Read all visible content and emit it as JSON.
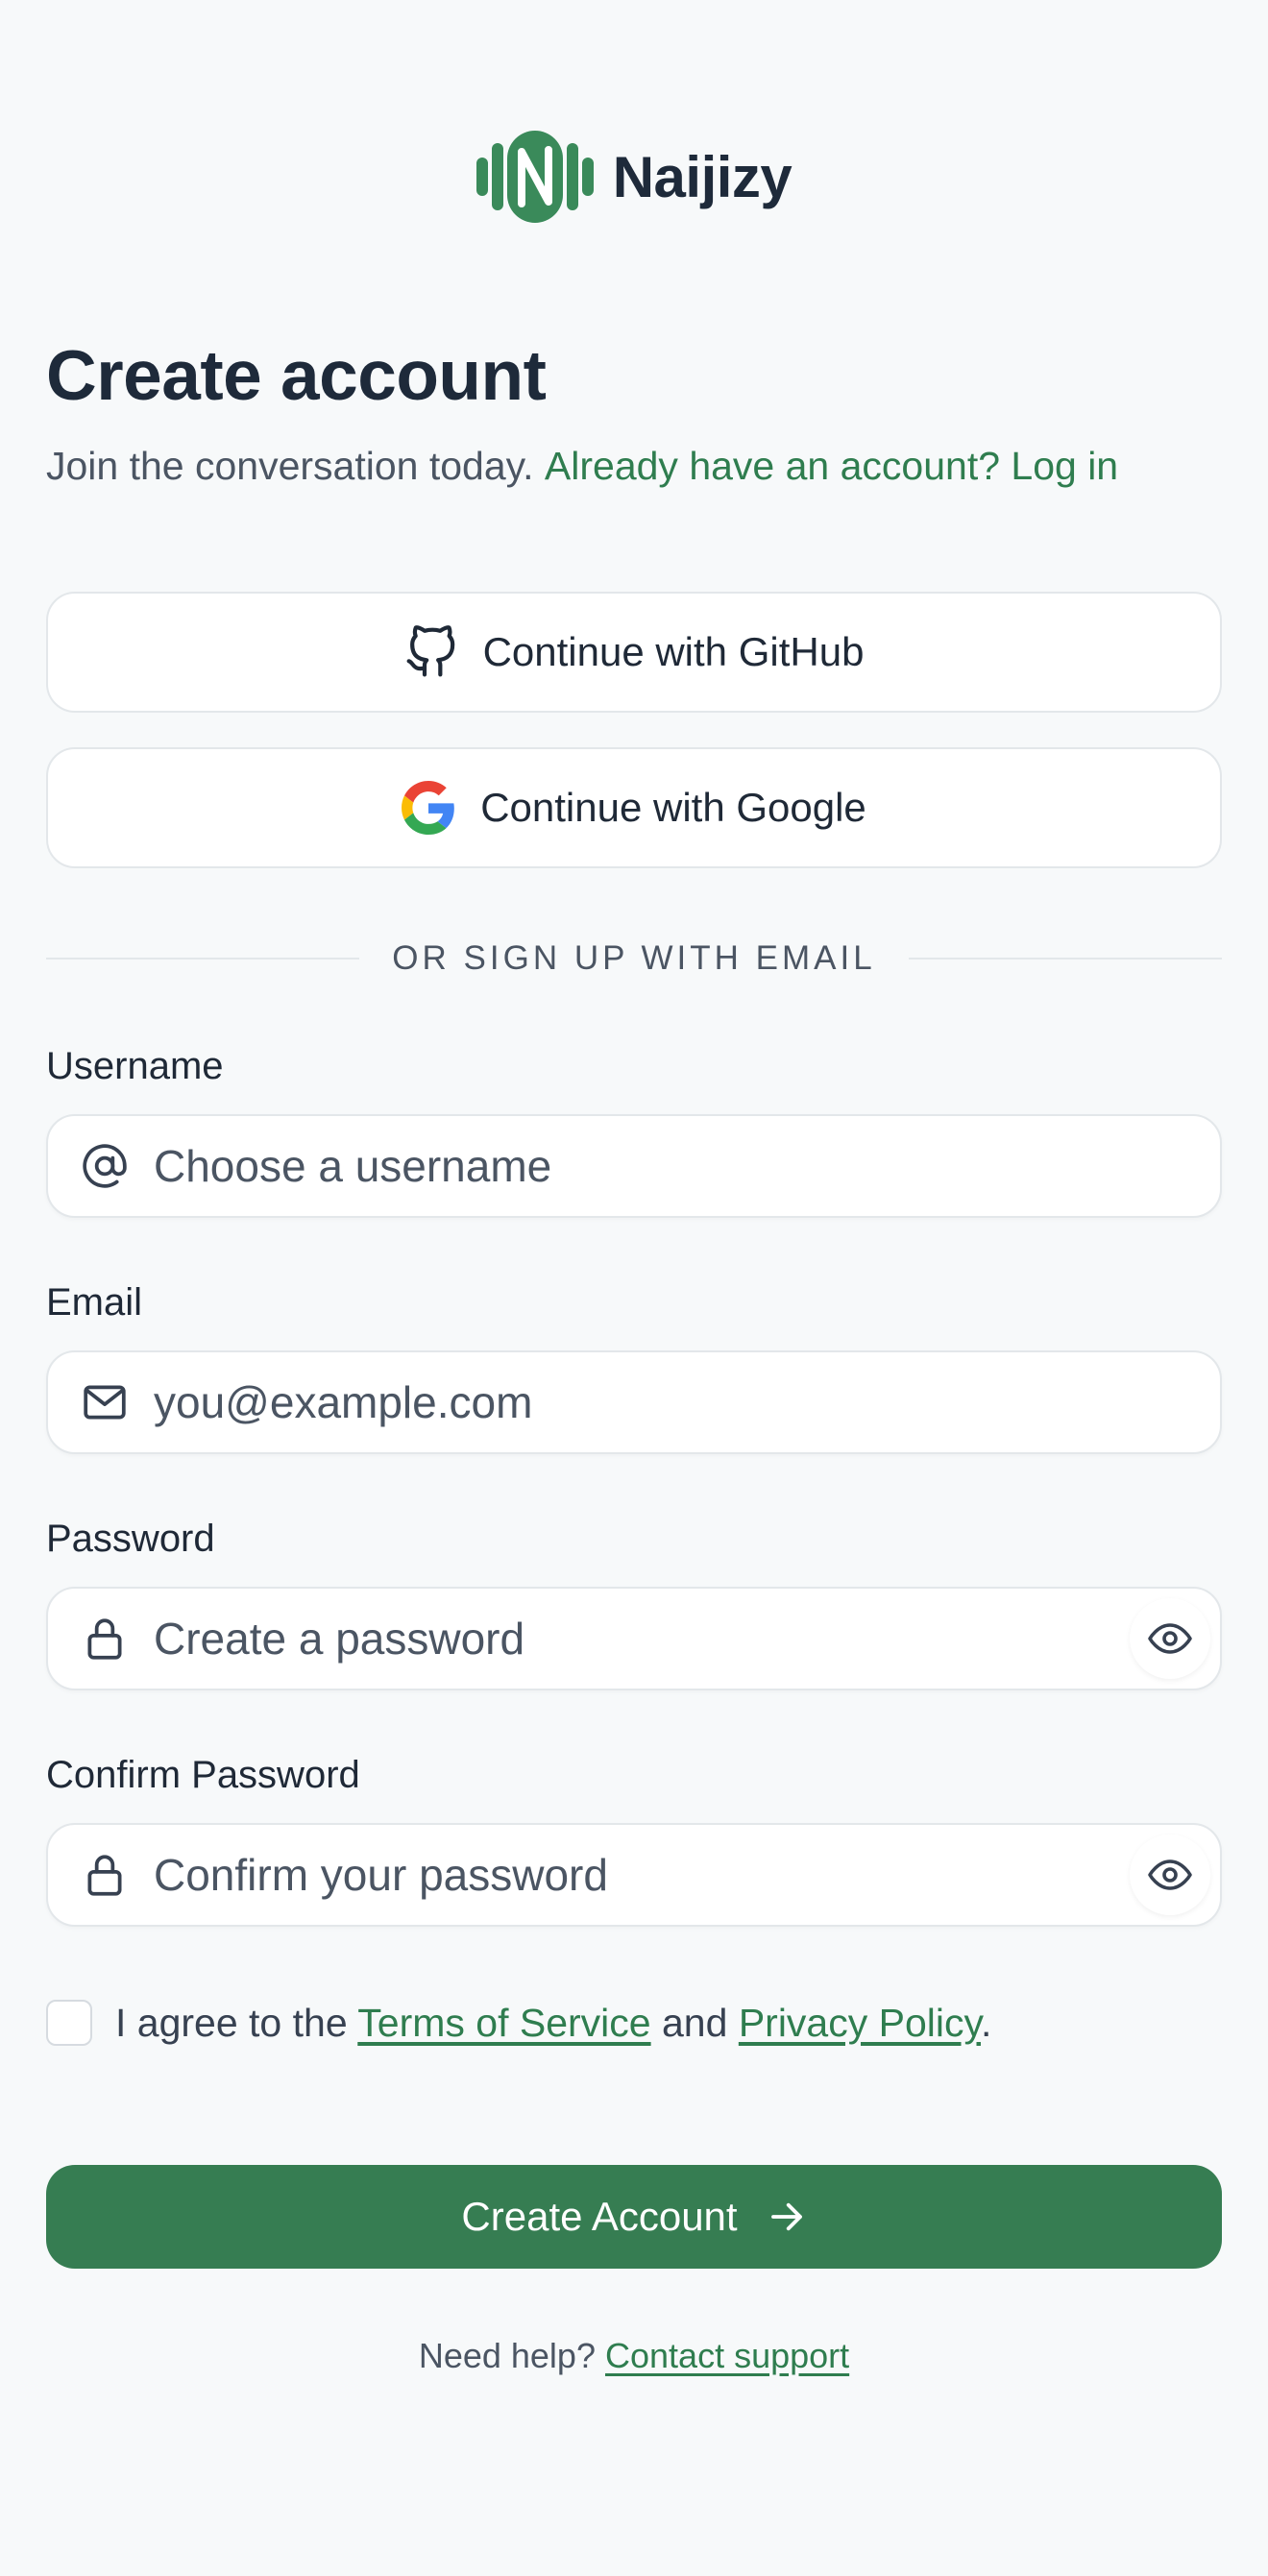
{
  "brand": {
    "name": "Naijizy",
    "color": "#3a8a5a"
  },
  "heading": {
    "title": "Create account",
    "subtitle": "Join the conversation today.",
    "login_link": "Already have an account? Log in"
  },
  "social": {
    "github_label": "Continue with GitHub",
    "google_label": "Continue with Google"
  },
  "divider_text": "OR SIGN UP WITH EMAIL",
  "form": {
    "username": {
      "label": "Username",
      "placeholder": "Choose a username",
      "icon": "at-icon"
    },
    "email": {
      "label": "Email",
      "placeholder": "you@example.com",
      "icon": "mail-icon"
    },
    "password": {
      "label": "Password",
      "placeholder": "Create a password",
      "icon": "lock-icon"
    },
    "confirm_password": {
      "label": "Confirm Password",
      "placeholder": "Confirm your password",
      "icon": "lock-icon"
    }
  },
  "terms": {
    "prefix": "I agree to the",
    "tos": "Terms of Service",
    "and": "and",
    "privacy": "Privacy Policy",
    "suffix": ".",
    "checked": false
  },
  "submit": {
    "label": "Create Account",
    "color": "#367d52"
  },
  "help": {
    "prefix": "Need help?",
    "link": "Contact support"
  },
  "colors": {
    "accent": "#2f7d4f",
    "background": "#f7f9fa",
    "heading": "#1e2a3a"
  }
}
